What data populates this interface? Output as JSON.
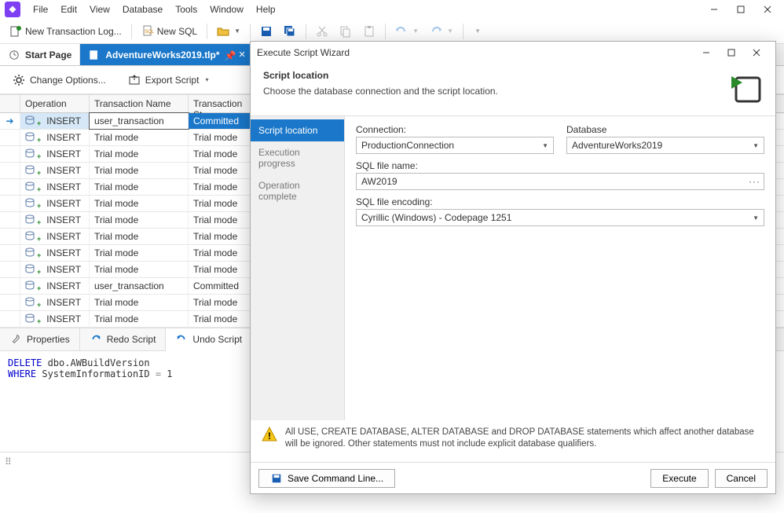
{
  "menu": {
    "items": [
      "File",
      "Edit",
      "View",
      "Database",
      "Tools",
      "Window",
      "Help"
    ]
  },
  "toolbar": {
    "new_log": "New Transaction Log...",
    "new_sql": "New SQL"
  },
  "tabs": {
    "start": "Start Page",
    "doc": "AdventureWorks2019.tlp*"
  },
  "options_bar": {
    "change": "Change Options...",
    "export": "Export Script"
  },
  "grid": {
    "headers": {
      "op": "Operation",
      "tn": "Transaction Name",
      "st": "Transaction St"
    },
    "rows": [
      {
        "op": "INSERT",
        "tn": "user_transaction",
        "st": "Committed",
        "selected": true
      },
      {
        "op": "INSERT",
        "tn": "Trial mode",
        "st": "Trial mode"
      },
      {
        "op": "INSERT",
        "tn": "Trial mode",
        "st": "Trial mode"
      },
      {
        "op": "INSERT",
        "tn": "Trial mode",
        "st": "Trial mode"
      },
      {
        "op": "INSERT",
        "tn": "Trial mode",
        "st": "Trial mode"
      },
      {
        "op": "INSERT",
        "tn": "Trial mode",
        "st": "Trial mode"
      },
      {
        "op": "INSERT",
        "tn": "Trial mode",
        "st": "Trial mode"
      },
      {
        "op": "INSERT",
        "tn": "Trial mode",
        "st": "Trial mode"
      },
      {
        "op": "INSERT",
        "tn": "Trial mode",
        "st": "Trial mode"
      },
      {
        "op": "INSERT",
        "tn": "Trial mode",
        "st": "Trial mode"
      },
      {
        "op": "INSERT",
        "tn": "user_transaction",
        "st": "Committed"
      },
      {
        "op": "INSERT",
        "tn": "Trial mode",
        "st": "Trial mode"
      },
      {
        "op": "INSERT",
        "tn": "Trial mode",
        "st": "Trial mode"
      }
    ]
  },
  "bottom_tabs": {
    "properties": "Properties",
    "redo": "Redo Script",
    "undo": "Undo Script"
  },
  "sql": {
    "line1_kw": "DELETE",
    "line1_rest": " dbo.AWBuildVersion",
    "line2_kw": "WHERE",
    "line2_col": " SystemInformationID ",
    "line2_op": "=",
    "line2_val": " 1"
  },
  "wizard": {
    "title": "Execute Script Wizard",
    "section_title": "Script location",
    "section_desc": "Choose the database connection and the script location.",
    "steps": [
      "Script location",
      "Execution progress",
      "Operation complete"
    ],
    "labels": {
      "connection": "Connection:",
      "database": "Database",
      "filename": "SQL file name:",
      "encoding": "SQL file encoding:"
    },
    "values": {
      "connection": "ProductionConnection",
      "database": "AdventureWorks2019",
      "filename": "AW2019",
      "encoding": "Cyrillic (Windows) - Codepage 1251"
    },
    "warning": "All USE, CREATE DATABASE, ALTER DATABASE and DROP DATABASE statements which affect another database will be ignored. Other statements must not include explicit database qualifiers.",
    "buttons": {
      "save_cmd": "Save Command Line...",
      "execute": "Execute",
      "cancel": "Cancel"
    }
  }
}
